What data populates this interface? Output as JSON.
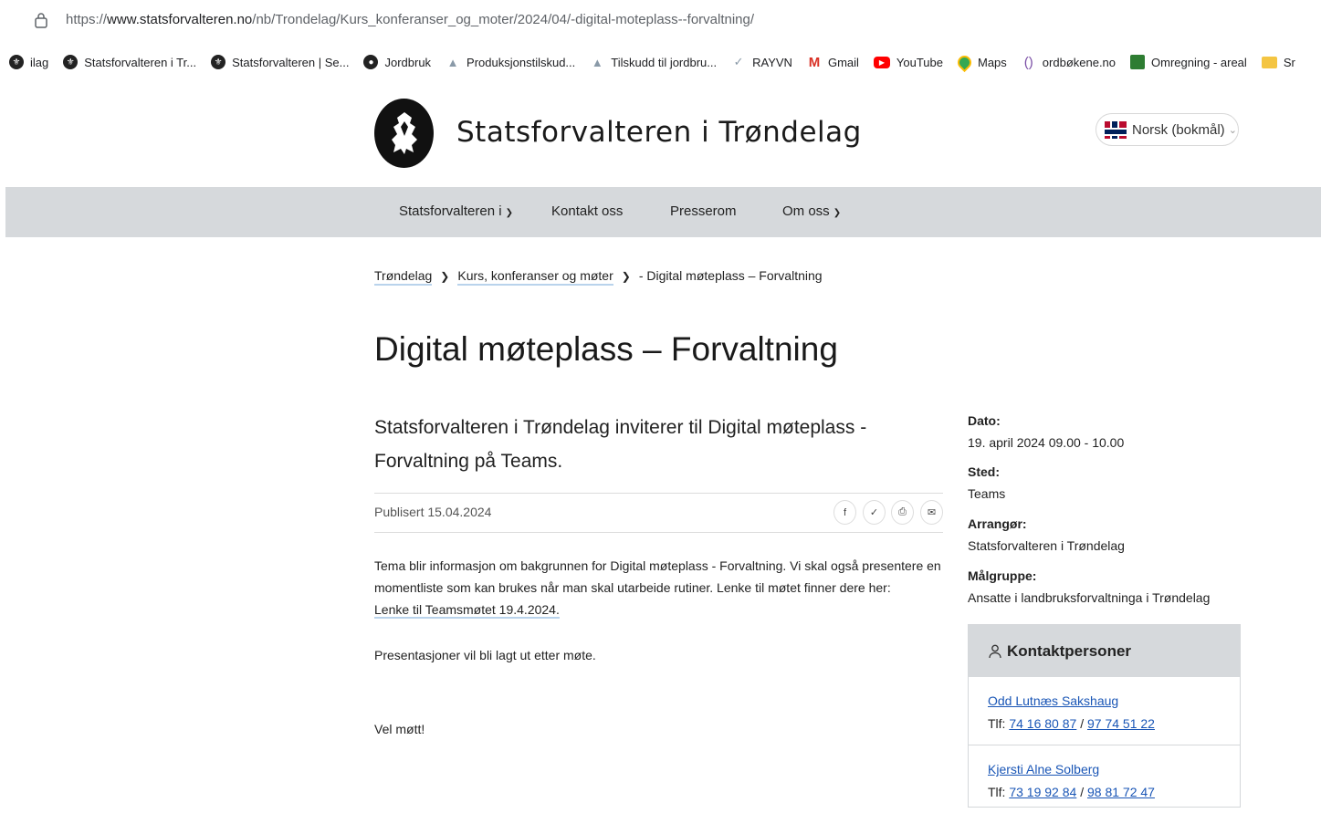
{
  "browser": {
    "url_prefix": "https://",
    "url_host": "www.statsforvalteren.no",
    "url_path": "/nb/Trondelag/Kurs_konferanser_og_moter/2024/04/-digital-moteplass--forvaltning/"
  },
  "bookmarks": [
    {
      "label": "ilag",
      "icon": "seal-icon"
    },
    {
      "label": "Statsforvalteren i Tr...",
      "icon": "seal-icon"
    },
    {
      "label": "Statsforvalteren | Se...",
      "icon": "seal-icon"
    },
    {
      "label": "Jordbruk",
      "icon": "globe-icon"
    },
    {
      "label": "Produksjonstilskud...",
      "icon": "mountain-icon"
    },
    {
      "label": "Tilskudd til jordbru...",
      "icon": "mountain-icon"
    },
    {
      "label": "RAYVN",
      "icon": "bird-icon"
    },
    {
      "label": "Gmail",
      "icon": "gmail-icon"
    },
    {
      "label": "YouTube",
      "icon": "youtube-icon"
    },
    {
      "label": "Maps",
      "icon": "maps-icon"
    },
    {
      "label": "ordbøkene.no",
      "icon": "parenthesis-icon"
    },
    {
      "label": "Omregning - areal",
      "icon": "square-icon"
    },
    {
      "label": "Sr",
      "icon": "folder-icon"
    }
  ],
  "header": {
    "site_title": "Statsforvalteren i Trøndelag",
    "language": "Norsk (bokmål)"
  },
  "nav": {
    "items": [
      "Statsforvalteren i",
      "Kontakt oss",
      "Presserom",
      "Om oss"
    ]
  },
  "breadcrumb": {
    "items": [
      "Trøndelag",
      "Kurs, konferanser og møter",
      "- Digital møteplass – Forvaltning"
    ]
  },
  "article": {
    "title": "Digital møteplass – Forvaltning",
    "lead": "Statsforvalteren i Trøndelag inviterer til Digital møteplass - Forvaltning på Teams.",
    "published": "Publisert 15.04.2024",
    "paragraph1": "Tema blir informasjon om bakgrunnen for Digital møteplass - Forvaltning. Vi skal også presentere en momentliste som kan brukes når man skal utarbeide rutiner. Lenke til møtet finner dere her:",
    "teams_link": "Lenke til Teamsmøtet 19.4.2024.",
    "paragraph2": "Presentasjoner vil bli lagt ut etter møte.",
    "paragraph3": "Vel møtt!"
  },
  "sidebar": {
    "date_label": "Dato:",
    "date_value": "19. april 2024 09.00 - 10.00",
    "place_label": "Sted:",
    "place_value": "Teams",
    "organizer_label": "Arrangør:",
    "organizer_value": "Statsforvalteren i Trøndelag",
    "audience_label": "Målgruppe:",
    "audience_value": "Ansatte i landbruksforvaltninga i Trøndelag",
    "contacts_title": "Kontaktpersoner",
    "tlf_label": "Tlf:",
    "contacts": [
      {
        "name": "Odd Lutnæs Sakshaug",
        "phone1": "74 16 80 87",
        "phone2": "97 74 51 22"
      },
      {
        "name": "Kjersti Alne Solberg",
        "phone1": "73 19 92 84",
        "phone2": "98 81 72 47"
      }
    ]
  }
}
